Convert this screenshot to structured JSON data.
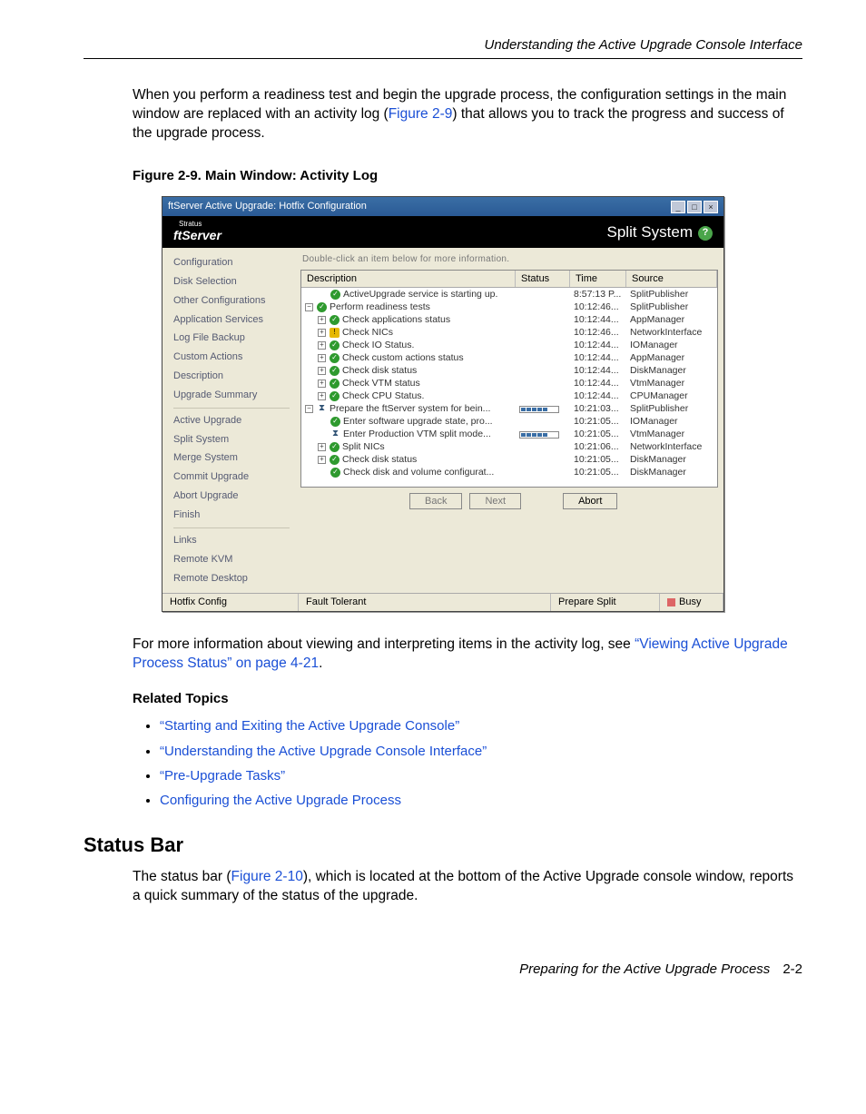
{
  "header": {
    "section_title": "Understanding the Active Upgrade Console Interface"
  },
  "para1": "When you perform a readiness test and begin the upgrade process, the configuration settings in the main window are replaced with an activity log (",
  "para1_link": "Figure 2-9",
  "para1_tail": ") that allows you to track the progress and success of the upgrade process.",
  "fig_caption": "Figure 2-9. Main Window: Activity Log",
  "window": {
    "title": "ftServer Active Upgrade: Hotfix Configuration",
    "brand_left": "ftServer",
    "brand_left_tiny": "Stratus",
    "brand_right": "Split System",
    "sidebar": {
      "items": [
        "Configuration",
        "Disk Selection",
        "Other Configurations",
        "Application Services",
        "Log File Backup",
        "Custom Actions",
        "Description",
        "Upgrade Summary"
      ],
      "items2": [
        "Active Upgrade",
        "Split System",
        "Merge System",
        "Commit Upgrade",
        "Abort Upgrade",
        "Finish"
      ],
      "links_label": "Links",
      "links": [
        "Remote KVM",
        "Remote Desktop"
      ]
    },
    "grid": {
      "note": "Double-click an item below for more information.",
      "headers": {
        "desc": "Description",
        "status": "Status",
        "time": "Time",
        "source": "Source"
      },
      "rows": [
        {
          "indent": 1,
          "exp": "",
          "icon": "ok",
          "desc": "ActiveUpgrade service is starting up.",
          "time": "8:57:13 P...",
          "src": "SplitPublisher"
        },
        {
          "indent": 0,
          "exp": "−",
          "icon": "ok",
          "desc": "Perform readiness tests",
          "time": "10:12:46...",
          "src": "SplitPublisher"
        },
        {
          "indent": 1,
          "exp": "+",
          "icon": "ok",
          "desc": "Check applications status",
          "time": "10:12:44...",
          "src": "AppManager"
        },
        {
          "indent": 1,
          "exp": "+",
          "icon": "warn",
          "desc": "Check NICs",
          "time": "10:12:46...",
          "src": "NetworkInterface"
        },
        {
          "indent": 1,
          "exp": "+",
          "icon": "ok",
          "desc": "Check IO Status.",
          "time": "10:12:44...",
          "src": "IOManager"
        },
        {
          "indent": 1,
          "exp": "+",
          "icon": "ok",
          "desc": "Check custom actions status",
          "time": "10:12:44...",
          "src": "AppManager"
        },
        {
          "indent": 1,
          "exp": "+",
          "icon": "ok",
          "desc": "Check disk status",
          "time": "10:12:44...",
          "src": "DiskManager"
        },
        {
          "indent": 1,
          "exp": "+",
          "icon": "ok",
          "desc": "Check VTM status",
          "time": "10:12:44...",
          "src": "VtmManager"
        },
        {
          "indent": 1,
          "exp": "+",
          "icon": "ok",
          "desc": "Check CPU Status.",
          "time": "10:12:44...",
          "src": "CPUManager"
        },
        {
          "indent": 0,
          "exp": "−",
          "icon": "hour",
          "desc": "Prepare the ftServer system for bein...",
          "time": "10:21:03...",
          "src": "SplitPublisher",
          "progress": true
        },
        {
          "indent": 1,
          "exp": "",
          "icon": "ok",
          "desc": "Enter software upgrade state, pro...",
          "time": "10:21:05...",
          "src": "IOManager"
        },
        {
          "indent": 1,
          "exp": "",
          "icon": "hour",
          "desc": "Enter Production VTM split mode...",
          "time": "10:21:05...",
          "src": "VtmManager",
          "progress": true
        },
        {
          "indent": 1,
          "exp": "+",
          "icon": "ok",
          "desc": "Split NICs",
          "time": "10:21:06...",
          "src": "NetworkInterface"
        },
        {
          "indent": 1,
          "exp": "+",
          "icon": "ok",
          "desc": "Check disk status",
          "time": "10:21:05...",
          "src": "DiskManager"
        },
        {
          "indent": 1,
          "exp": "",
          "icon": "ok",
          "desc": "Check disk and volume configurat...",
          "time": "10:21:05...",
          "src": "DiskManager"
        }
      ]
    },
    "buttons": {
      "back": "Back",
      "next": "Next",
      "abort": "Abort"
    },
    "statusbar": {
      "left": "Hotfix Config",
      "mid1": "Fault Tolerant",
      "mid2": "Prepare Split",
      "right": "Busy"
    }
  },
  "para2_a": "For more information about viewing and interpreting items in the activity log, see ",
  "para2_link": "“Viewing Active Upgrade Process Status” on page 4-21",
  "para2_b": ".",
  "related_head": "Related Topics",
  "topics": [
    "Starting and Exiting the Active Upgrade Console",
    "Understanding the Active Upgrade Console Interface",
    "Pre-Upgrade Tasks",
    "Configuring the Active Upgrade Process"
  ],
  "section2_head": "Status Bar",
  "section2_body_a": "The status bar (",
  "section2_link": "Figure 2-10",
  "section2_body_b": "), which is located at the bottom of the Active Upgrade console window, reports a quick summary of the status of the upgrade.",
  "footer": {
    "text": "Preparing for the Active Upgrade Process",
    "page": "2-2"
  }
}
